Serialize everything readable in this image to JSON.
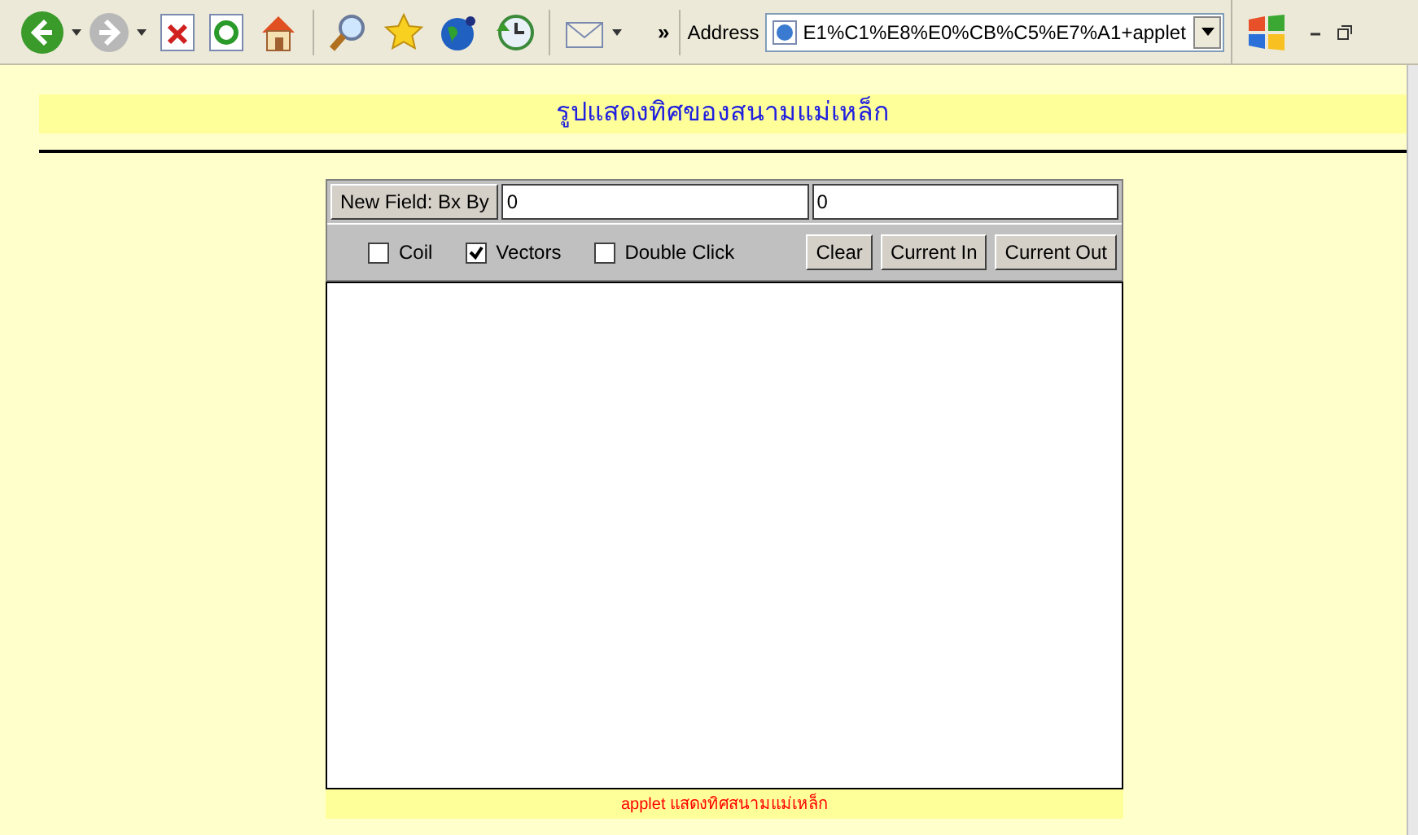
{
  "toolbar": {
    "more": "»",
    "address_label": "Address",
    "address_value": "E1%C1%E8%E0%CB%C5%E7%A1+applet"
  },
  "page": {
    "title": "รูปแสดงทิศของสนามแม่เหล็ก",
    "caption": "applet แสดงทิศสนามแม่เหล็ก"
  },
  "applet": {
    "field_button": "New Field: Bx By",
    "bx": "0",
    "by": "0",
    "checkboxes": [
      {
        "label": "Coil",
        "checked": false
      },
      {
        "label": "Vectors",
        "checked": true
      },
      {
        "label": "Double Click",
        "checked": false
      }
    ],
    "buttons": [
      "Clear",
      "Current In",
      "Current Out"
    ]
  }
}
